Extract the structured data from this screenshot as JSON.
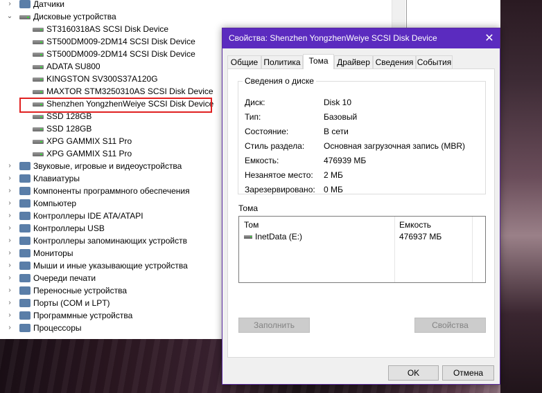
{
  "device_manager": {
    "categories_top": [
      {
        "label": "Датчики",
        "expander": "›"
      },
      {
        "label": "Дисковые устройства",
        "expander": "⌄"
      }
    ],
    "disk_devices": [
      "ST3160318AS SCSI Disk Device",
      "ST500DM009-2DM14 SCSI Disk Device",
      "ST500DM009-2DM14 SCSI Disk Device",
      "ADATA SU800",
      "KINGSTON SV300S37A120G",
      "MAXTOR STM3250310AS SCSI Disk Device",
      "Shenzhen YongzhenWeiye SCSI Disk Device",
      "SSD 128GB",
      "SSD 128GB",
      "XPG GAMMIX S11 Pro",
      "XPG GAMMIX S11 Pro"
    ],
    "selected_device_index": 6,
    "categories_bottom": [
      "Звуковые, игровые и видеоустройства",
      "Клавиатуры",
      "Компоненты программного обеспечения",
      "Компьютер",
      "Контроллеры IDE ATA/ATAPI",
      "Контроллеры USB",
      "Контроллеры запоминающих устройств",
      "Мониторы",
      "Мыши и иные указывающие устройства",
      "Очереди печати",
      "Переносные устройства",
      "Порты (COM и LPT)",
      "Программные устройства",
      "Процессоры"
    ],
    "expander_collapsed": "›",
    "colors": {
      "highlight_box": "#e02020"
    }
  },
  "dialog": {
    "title": "Свойства: Shenzhen YongzhenWeiye SCSI Disk Device",
    "close_glyph": "✕",
    "tabs": [
      "Общие",
      "Политика",
      "Тома",
      "Драйвер",
      "Сведения",
      "События"
    ],
    "active_tab": "Тома",
    "disk_info": {
      "group_title": "Сведения о диске",
      "rows": [
        {
          "label": "Диск:",
          "value": "Disk 10"
        },
        {
          "label": "Тип:",
          "value": "Базовый"
        },
        {
          "label": "Состояние:",
          "value": "В сети"
        },
        {
          "label": "Стиль раздела:",
          "value": "Основная загрузочная запись (MBR)"
        },
        {
          "label": "Емкость:",
          "value": "476939 МБ"
        },
        {
          "label": "Незанятое место:",
          "value": "2 МБ"
        },
        {
          "label": "Зарезервировано:",
          "value": "0 МБ"
        }
      ]
    },
    "volumes": {
      "section_title": "Тома",
      "columns": [
        "Том",
        "Емкость"
      ],
      "rows": [
        {
          "volume": "InetData (E:)",
          "capacity": "476937 МБ"
        }
      ]
    },
    "buttons": {
      "populate": "Заполнить",
      "properties": "Свойства",
      "ok": "OK",
      "cancel": "Отмена"
    },
    "colors": {
      "titlebar": "#5b2bbf"
    }
  }
}
